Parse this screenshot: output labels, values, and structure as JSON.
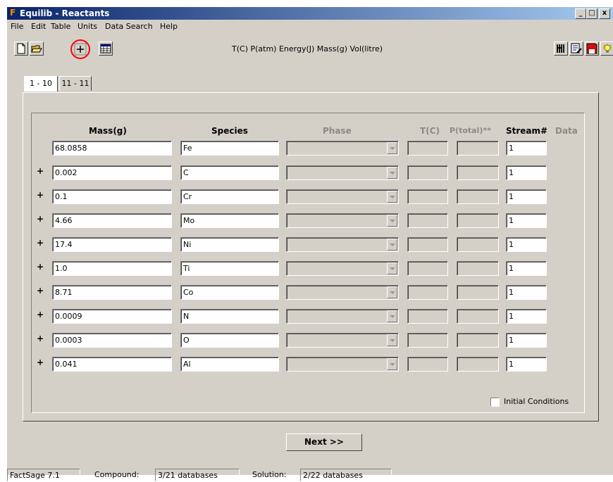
{
  "window": {
    "logo_letter": "F",
    "title": "Equilib - Reactants",
    "buttons": [
      "_",
      "□",
      "x"
    ]
  },
  "menu": [
    "File",
    "Edit",
    "Table",
    "Units",
    "Data Search",
    "Help"
  ],
  "toolbar": {
    "units_text": "T(C) P(atm) Energy(J) Mass(g) Vol(litre)",
    "left_icons": [
      "new-file-icon",
      "open-folder-icon",
      "add-icon",
      "table-icon"
    ],
    "right_icons": [
      "utensils-icon",
      "edit-list-icon",
      "save-icon",
      "lightbulb-icon"
    ],
    "highlight_color": "#ff0000"
  },
  "tabs": [
    "1 - 10",
    "11 - 11"
  ],
  "headers": {
    "mass": "Mass(g)",
    "species": "Species",
    "phase": "Phase",
    "temp": "T(C)",
    "ptotal": "P(total)**",
    "stream": "Stream#",
    "data": "Data"
  },
  "plus_sign": "+",
  "rows": [
    {
      "mass": "68.0858",
      "species": "Fe",
      "stream": "1"
    },
    {
      "mass": "0.002",
      "species": "C",
      "stream": "1"
    },
    {
      "mass": "0.1",
      "species": "Cr",
      "stream": "1"
    },
    {
      "mass": "4.66",
      "species": "Mo",
      "stream": "1"
    },
    {
      "mass": "17.4",
      "species": "Ni",
      "stream": "1"
    },
    {
      "mass": "1.0",
      "species": "Ti",
      "stream": "1"
    },
    {
      "mass": "8.71",
      "species": "Co",
      "stream": "1"
    },
    {
      "mass": "0.0009",
      "species": "N",
      "stream": "1"
    },
    {
      "mass": "0.0003",
      "species": "O",
      "stream": "1"
    },
    {
      "mass": "0.041",
      "species": "Al",
      "stream": "1"
    }
  ],
  "initial_conditions": {
    "label": "Initial Conditions",
    "checked": false
  },
  "next_button": "Next >>",
  "status": {
    "app": "FactSage 7.1",
    "compound_label": "Compound:",
    "compound_value": "3/21 databases",
    "solution_label": "Solution:",
    "solution_value": "2/22 databases"
  }
}
